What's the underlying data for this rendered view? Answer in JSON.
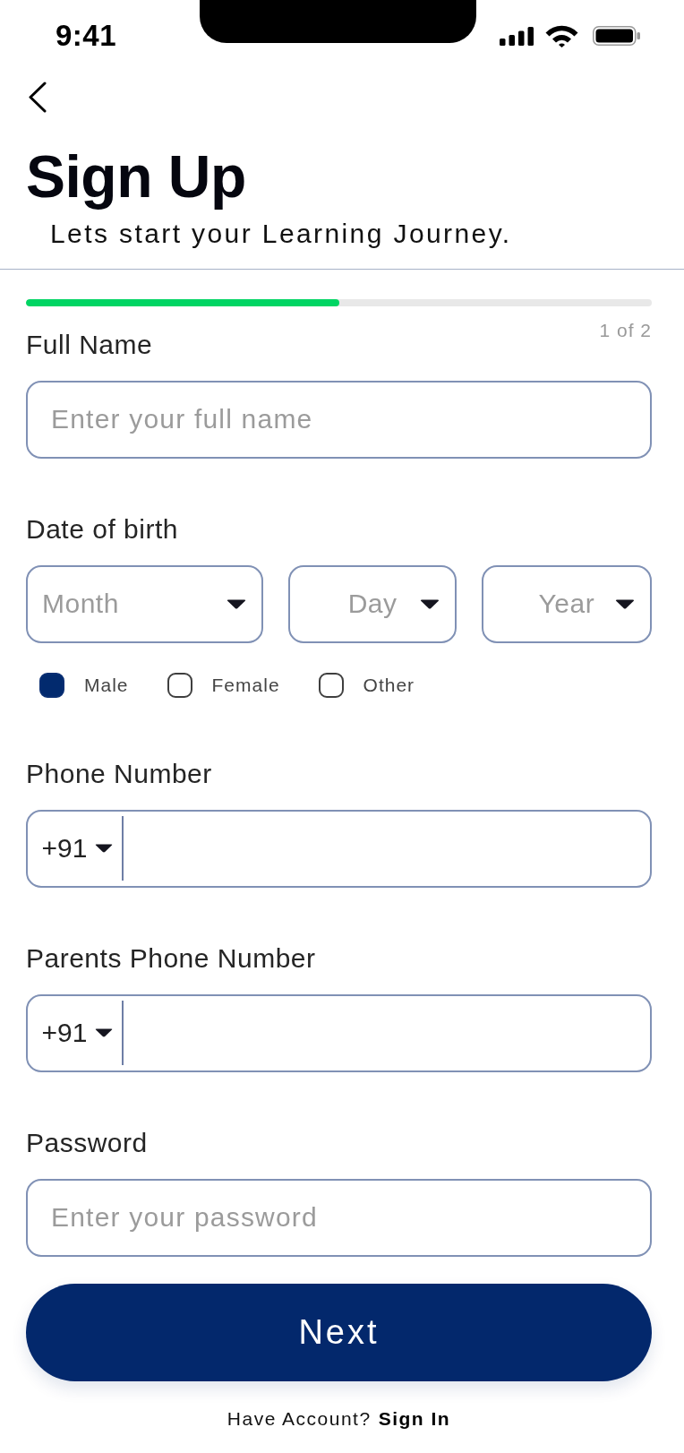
{
  "status_bar": {
    "time": "9:41"
  },
  "header": {
    "title": "Sign Up",
    "subtitle": "Lets start your Learning Journey."
  },
  "progress": {
    "level": 0.5,
    "step": "1 of 2"
  },
  "fields": [
    {
      "kind": "text",
      "label": "Full Name",
      "placeholder": "Enter your full name"
    },
    {
      "kind": "date",
      "label": "Date of birth",
      "selects": [
        {
          "placeholder": "Month"
        },
        {
          "placeholder": "Day"
        },
        {
          "placeholder": "Year"
        }
      ]
    },
    {
      "kind": "choice",
      "options": [
        {
          "label": "Male",
          "selected": true
        },
        {
          "label": "Female",
          "selected": false
        },
        {
          "label": "Other",
          "selected": false
        }
      ]
    },
    {
      "kind": "phone",
      "label": "Phone Number",
      "country_code": "+91"
    },
    {
      "kind": "phone",
      "label": "Parents Phone Number",
      "country_code": "+91"
    },
    {
      "kind": "password",
      "label": "Password",
      "placeholder": "Enter your password"
    }
  ],
  "next_button": {
    "label": "Next"
  },
  "footer": {
    "prompt": "Have Account?",
    "link": "Sign In"
  }
}
